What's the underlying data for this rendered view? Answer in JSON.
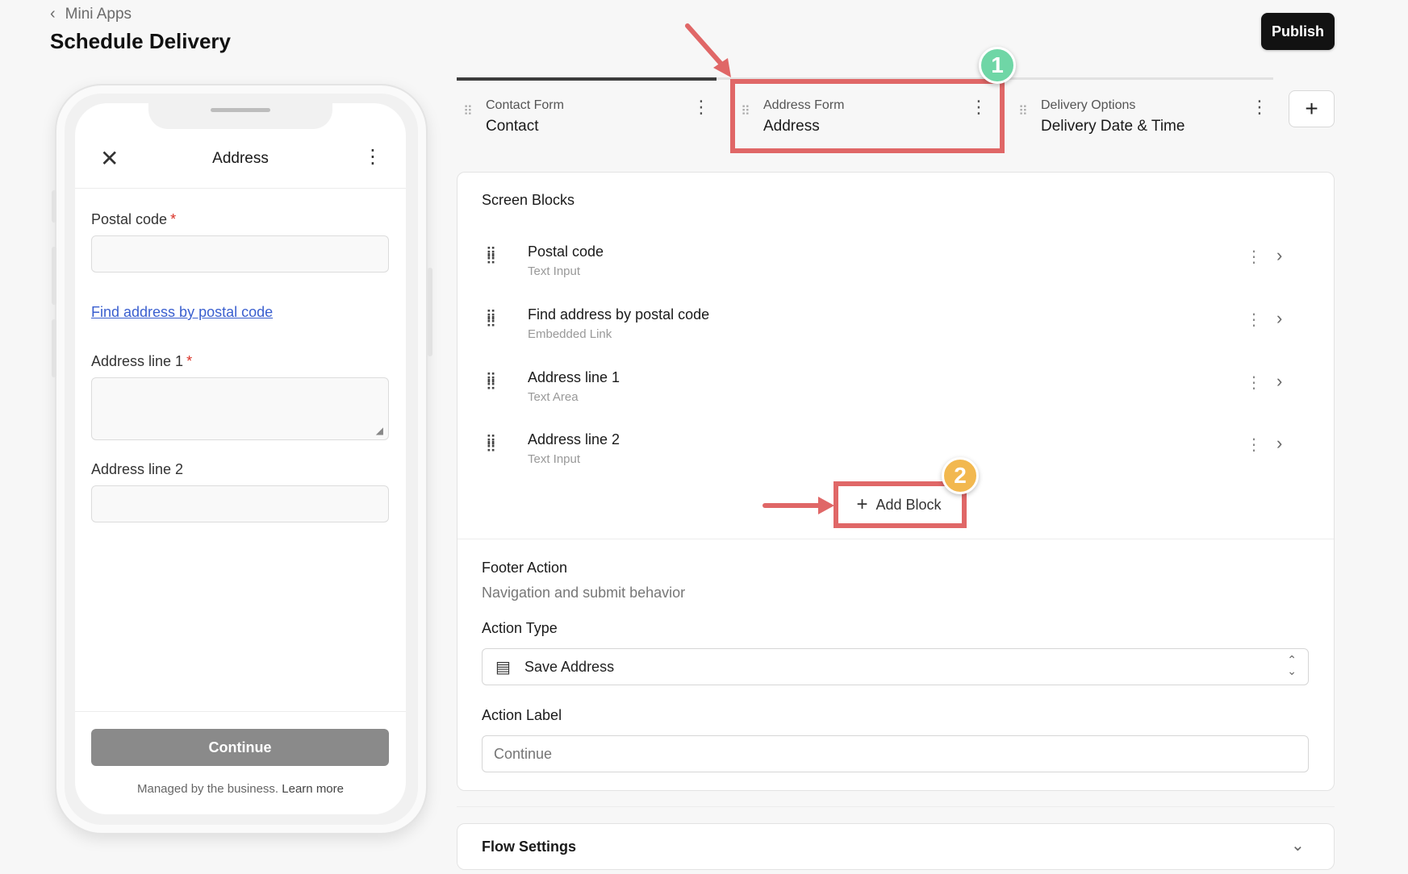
{
  "header": {
    "breadcrumb": "Mini Apps",
    "title": "Schedule Delivery",
    "publish_label": "Publish"
  },
  "preview": {
    "screen_title": "Address",
    "fields": {
      "postal_code_label": "Postal code",
      "required_mark": "*",
      "find_link": "Find address by postal code",
      "address1_label": "Address line 1",
      "address2_label": "Address line 2"
    },
    "continue_label": "Continue",
    "managed_text": "Managed by the business.",
    "learn_more": "Learn more"
  },
  "tabs": [
    {
      "label": "Contact Form",
      "value": "Contact"
    },
    {
      "label": "Address Form",
      "value": "Address"
    },
    {
      "label": "Delivery Options",
      "value": "Delivery Date & Time"
    }
  ],
  "annotations": {
    "badge1": "1",
    "badge2": "2",
    "highlight_color": "#e06767",
    "badge1_color": "#6fd6a6",
    "badge2_color": "#f2b84f"
  },
  "screen_blocks": {
    "title": "Screen Blocks",
    "items": [
      {
        "title": "Postal code",
        "type": "Text Input"
      },
      {
        "title": "Find address by postal code",
        "type": "Embedded Link"
      },
      {
        "title": "Address line 1",
        "type": "Text Area"
      },
      {
        "title": "Address line 2",
        "type": "Text Input"
      }
    ],
    "add_block_label": "Add Block"
  },
  "footer_action": {
    "title": "Footer Action",
    "subtitle": "Navigation and submit behavior",
    "action_type_label": "Action Type",
    "action_type_value": "Save Address",
    "action_label_label": "Action Label",
    "action_label_placeholder": "Continue"
  },
  "flow_settings": {
    "title": "Flow Settings"
  }
}
